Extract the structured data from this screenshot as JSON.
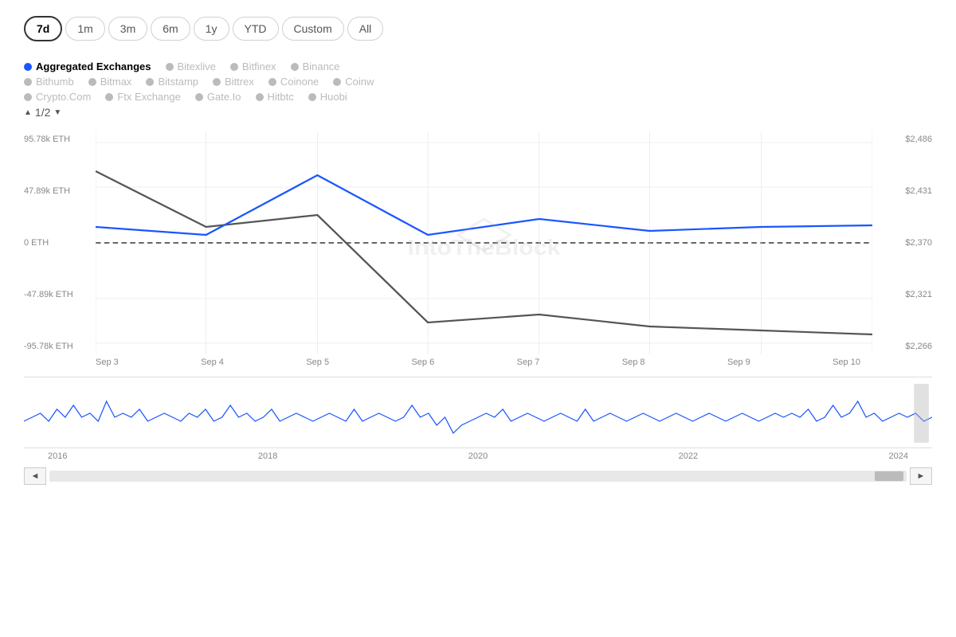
{
  "timeRange": {
    "buttons": [
      "7d",
      "1m",
      "3m",
      "6m",
      "1y",
      "YTD",
      "Custom",
      "All"
    ],
    "active": "7d"
  },
  "legend": {
    "page": "1/2",
    "rows": [
      [
        {
          "label": "Aggregated Exchanges",
          "active": true,
          "color": "blue"
        },
        {
          "label": "Bitexlive",
          "active": false,
          "color": "gray"
        },
        {
          "label": "Bitfinex",
          "active": false,
          "color": "gray"
        },
        {
          "label": "Binance",
          "active": false,
          "color": "gray"
        }
      ],
      [
        {
          "label": "Bithumb",
          "active": false,
          "color": "gray"
        },
        {
          "label": "Bitmax",
          "active": false,
          "color": "gray"
        },
        {
          "label": "Bitstamp",
          "active": false,
          "color": "gray"
        },
        {
          "label": "Bittrex",
          "active": false,
          "color": "gray"
        },
        {
          "label": "Coinone",
          "active": false,
          "color": "gray"
        },
        {
          "label": "Coinw",
          "active": false,
          "color": "gray"
        }
      ],
      [
        {
          "label": "Crypto.Com",
          "active": false,
          "color": "gray"
        },
        {
          "label": "Ftx Exchange",
          "active": false,
          "color": "gray"
        },
        {
          "label": "Gate.Io",
          "active": false,
          "color": "gray"
        },
        {
          "label": "Hitbtc",
          "active": false,
          "color": "gray"
        },
        {
          "label": "Huobi",
          "active": false,
          "color": "gray"
        }
      ]
    ]
  },
  "yAxisLeft": [
    "95.78k ETH",
    "47.89k ETH",
    "0 ETH",
    "-47.89k ETH",
    "-95.78k ETH"
  ],
  "yAxisRight": [
    "$2,486",
    "$2,431",
    "$2,370",
    "$2,321",
    "$2,266"
  ],
  "xAxisLabels": [
    "Sep 3",
    "Sep 4",
    "Sep 5",
    "Sep 6",
    "Sep 7",
    "Sep 8",
    "Sep 9",
    "Sep 10"
  ],
  "miniXLabels": [
    "2016",
    "2018",
    "2020",
    "2022",
    "2024"
  ],
  "watermark": "IntoTheBlock",
  "scrollbar": {
    "leftLabel": "◄",
    "rightLabel": "►"
  }
}
